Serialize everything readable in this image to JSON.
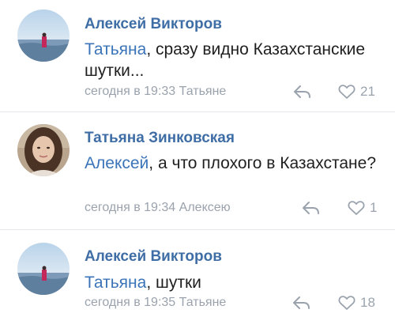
{
  "comments": [
    {
      "author": "Алексей Викторов",
      "mention": "Татьяна",
      "text_rest": ", сразу видно Казахстанские шутки...",
      "time": "сегодня в 19:33",
      "reply_to": "Татьяне",
      "likes": "21",
      "avatar": "sea-sunset-avatar"
    },
    {
      "author": "Татьяна Зинковская",
      "mention": "Алексей",
      "text_rest": ", а что плохого в Казахстане?",
      "time": "сегодня в 19:34",
      "reply_to": "Алексею",
      "likes": "1",
      "avatar": "woman-portrait-avatar"
    },
    {
      "author": "Алексей Викторов",
      "mention": "Татьяна",
      "text_rest": ", шутки",
      "time": "сегодня в 19:35",
      "reply_to": "Татьяне",
      "likes": "18",
      "avatar": "sea-sunset-avatar"
    }
  ],
  "icons": {
    "reply": "reply-arrow-icon",
    "like": "heart-outline-icon"
  },
  "colors": {
    "author": "#3f6ea6",
    "mention": "#3b74b8",
    "text": "#1f1f1f",
    "meta": "#9aa3ad",
    "divider": "#e3e6ea"
  }
}
